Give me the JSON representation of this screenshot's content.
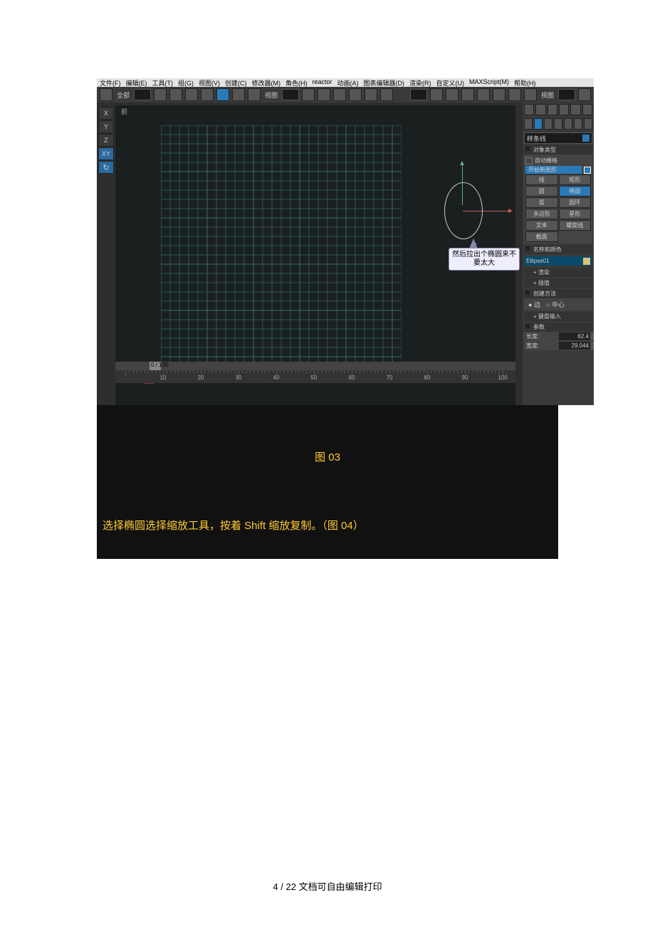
{
  "menubar": {
    "items": [
      "文件(F)",
      "编辑(E)",
      "工具(T)",
      "组(G)",
      "视图(V)",
      "创建(C)",
      "修改器(M)",
      "角色(H)",
      "reactor",
      "动画(A)",
      "图表编辑器(D)",
      "渲染(R)",
      "自定义(U)",
      "MAXScript(M)",
      "帮助(H)"
    ]
  },
  "toolbar": {
    "set_label": "全部",
    "view_label": "视图"
  },
  "axis": {
    "items": [
      "X",
      "Y",
      "Z",
      "XY"
    ],
    "active": 3
  },
  "viewport": {
    "label": "前",
    "slider_text": "0 / 100",
    "ticks": [
      10,
      20,
      30,
      40,
      50,
      60,
      70,
      80,
      90,
      100
    ]
  },
  "callout": {
    "text": "然后拉出个椭圆来不要太大"
  },
  "panel": {
    "dropdown": "样条线",
    "rollouts": {
      "object_type": "对象类型",
      "autogrid": "自动栅格",
      "start_new": "开始新图形",
      "name_color": "名称和颜色",
      "render": "渲染",
      "interp": "插值",
      "create_method": "创建方法",
      "edge": "边",
      "center": "中心",
      "keyboard": "键盘输入",
      "params": "参数",
      "length_label": "长度:",
      "length_val": "62.4",
      "width_label": "宽度:",
      "width_val": "29.044"
    },
    "shape_buttons": [
      [
        "线",
        "矩形"
      ],
      [
        "圆",
        "椭圆"
      ],
      [
        "弧",
        "圆环"
      ],
      [
        "多边形",
        "星形"
      ],
      [
        "文本",
        "螺旋线"
      ],
      [
        "截面",
        ""
      ]
    ],
    "selected_shape": "椭圆",
    "object_name": "Ellipse01"
  },
  "under": {
    "caption": "图 03",
    "instruction": "选择椭圆选择缩放工具，按着 Shift 缩放复制。（图 04）"
  },
  "footer": {
    "page": "4",
    "total": "22",
    "note": "文档可自由编辑打印"
  }
}
